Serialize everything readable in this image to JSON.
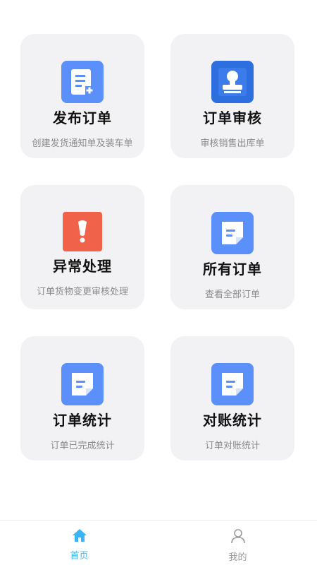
{
  "colors": {
    "card_bg": "#f2f2f4",
    "icon_blue": "#5b8ff9",
    "icon_red": "#f0624a",
    "tab_active": "#3ab4f2",
    "tab_inactive": "#9a9a9a"
  },
  "cards": [
    {
      "title": "发布订单",
      "desc": "创建发货通知单及装车单",
      "icon": "document-add-icon"
    },
    {
      "title": "订单审核",
      "desc": "审核销售出库单",
      "icon": "stamp-icon"
    },
    {
      "title": "异常处理",
      "desc": "订单货物变更审核处理",
      "icon": "exclamation-icon"
    },
    {
      "title": "所有订单",
      "desc": "查看全部订单",
      "icon": "note-icon"
    },
    {
      "title": "订单统计",
      "desc": "订单已完成统计",
      "icon": "note-icon"
    },
    {
      "title": "对账统计",
      "desc": "订单对账统计",
      "icon": "note-icon"
    }
  ],
  "tabbar": {
    "items": [
      {
        "label": "首页",
        "icon": "home-icon",
        "active": true
      },
      {
        "label": "我的",
        "icon": "user-icon",
        "active": false
      }
    ]
  }
}
